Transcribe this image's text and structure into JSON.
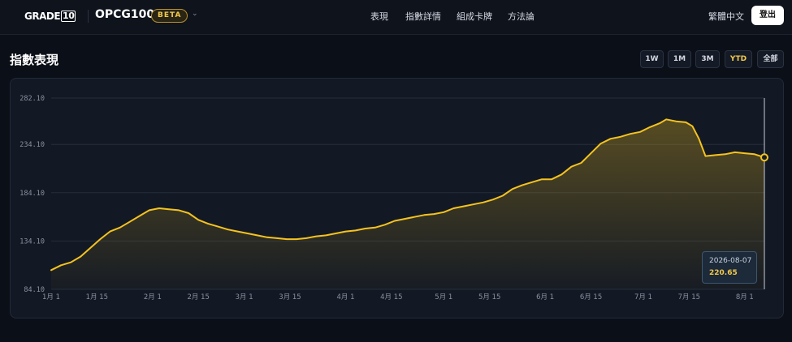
{
  "header": {
    "logo_text": "GRADE",
    "logo_box": "10",
    "index_name": "OPCG100",
    "badge": "BETA",
    "nav": [
      "表現",
      "指數詳情",
      "組成卡牌",
      "方法論"
    ],
    "language": "繁體中文",
    "logout_label": "登出"
  },
  "section": {
    "title": "指數表現",
    "ranges": [
      "1W",
      "1M",
      "3M",
      "YTD",
      "全部"
    ],
    "active_range": "YTD"
  },
  "tooltip": {
    "date": "2026-08-07",
    "value": "220.65"
  },
  "colors": {
    "line": "#f5c31f",
    "accent": "#f2c94c",
    "grid": "#252d3b",
    "tick": "#8a90a0"
  },
  "chart_data": {
    "type": "area",
    "x_start": "2026-01-01",
    "x_end": "2026-08-07",
    "ylim": [
      84.1,
      282.1
    ],
    "yticks": [
      "282.10",
      "234.10",
      "184.10",
      "134.10",
      "84.10"
    ],
    "ytick_values": [
      282.1,
      234.1,
      184.1,
      134.1,
      84.1
    ],
    "xticks": [
      {
        "label": "1月 1",
        "date": "2026-01-01"
      },
      {
        "label": "1月 15",
        "date": "2026-01-15"
      },
      {
        "label": "2月 1",
        "date": "2026-02-01"
      },
      {
        "label": "2月 15",
        "date": "2026-02-15"
      },
      {
        "label": "3月 1",
        "date": "2026-03-01"
      },
      {
        "label": "3月 15",
        "date": "2026-03-15"
      },
      {
        "label": "4月 1",
        "date": "2026-04-01"
      },
      {
        "label": "4月 15",
        "date": "2026-04-15"
      },
      {
        "label": "5月 1",
        "date": "2026-05-01"
      },
      {
        "label": "5月 15",
        "date": "2026-05-15"
      },
      {
        "label": "6月 1",
        "date": "2026-06-01"
      },
      {
        "label": "6月 15",
        "date": "2026-06-15"
      },
      {
        "label": "7月 1",
        "date": "2026-07-01"
      },
      {
        "label": "7月 15",
        "date": "2026-07-15"
      },
      {
        "label": "8月 1",
        "date": "2026-08-01"
      }
    ],
    "grid": true,
    "series": [
      {
        "points": [
          [
            "2026-01-01",
            104
          ],
          [
            "2026-01-04",
            109
          ],
          [
            "2026-01-07",
            112
          ],
          [
            "2026-01-10",
            118
          ],
          [
            "2026-01-13",
            127
          ],
          [
            "2026-01-16",
            136
          ],
          [
            "2026-01-19",
            144
          ],
          [
            "2026-01-22",
            148
          ],
          [
            "2026-01-25",
            154
          ],
          [
            "2026-01-28",
            160
          ],
          [
            "2026-01-31",
            166
          ],
          [
            "2026-02-03",
            168
          ],
          [
            "2026-02-06",
            167
          ],
          [
            "2026-02-09",
            166
          ],
          [
            "2026-02-12",
            163
          ],
          [
            "2026-02-15",
            156
          ],
          [
            "2026-02-18",
            152
          ],
          [
            "2026-02-21",
            149
          ],
          [
            "2026-02-24",
            146
          ],
          [
            "2026-02-27",
            144
          ],
          [
            "2026-03-02",
            142
          ],
          [
            "2026-03-05",
            140
          ],
          [
            "2026-03-08",
            138
          ],
          [
            "2026-03-11",
            137
          ],
          [
            "2026-03-14",
            136
          ],
          [
            "2026-03-17",
            136
          ],
          [
            "2026-03-20",
            137
          ],
          [
            "2026-03-23",
            139
          ],
          [
            "2026-03-26",
            140
          ],
          [
            "2026-03-29",
            142
          ],
          [
            "2026-04-01",
            144
          ],
          [
            "2026-04-04",
            145
          ],
          [
            "2026-04-07",
            147
          ],
          [
            "2026-04-10",
            148
          ],
          [
            "2026-04-13",
            151
          ],
          [
            "2026-04-16",
            155
          ],
          [
            "2026-04-19",
            157
          ],
          [
            "2026-04-22",
            159
          ],
          [
            "2026-04-25",
            161
          ],
          [
            "2026-04-28",
            162
          ],
          [
            "2026-05-01",
            164
          ],
          [
            "2026-05-04",
            168
          ],
          [
            "2026-05-07",
            170
          ],
          [
            "2026-05-10",
            172
          ],
          [
            "2026-05-13",
            174
          ],
          [
            "2026-05-16",
            177
          ],
          [
            "2026-05-19",
            181
          ],
          [
            "2026-05-22",
            188
          ],
          [
            "2026-05-25",
            192
          ],
          [
            "2026-05-28",
            195
          ],
          [
            "2026-05-31",
            198
          ],
          [
            "2026-06-03",
            198
          ],
          [
            "2026-06-06",
            203
          ],
          [
            "2026-06-09",
            211
          ],
          [
            "2026-06-12",
            215
          ],
          [
            "2026-06-15",
            225
          ],
          [
            "2026-06-18",
            235
          ],
          [
            "2026-06-21",
            240
          ],
          [
            "2026-06-24",
            242
          ],
          [
            "2026-06-27",
            245
          ],
          [
            "2026-06-30",
            247
          ],
          [
            "2026-07-03",
            252
          ],
          [
            "2026-07-06",
            256
          ],
          [
            "2026-07-08",
            260
          ],
          [
            "2026-07-11",
            258
          ],
          [
            "2026-07-14",
            257
          ],
          [
            "2026-07-16",
            253
          ],
          [
            "2026-07-18",
            240
          ],
          [
            "2026-07-20",
            222
          ],
          [
            "2026-07-23",
            223
          ],
          [
            "2026-07-26",
            224
          ],
          [
            "2026-07-29",
            226
          ],
          [
            "2026-08-01",
            225
          ],
          [
            "2026-08-04",
            224
          ],
          [
            "2026-08-07",
            220.65
          ]
        ]
      }
    ]
  }
}
